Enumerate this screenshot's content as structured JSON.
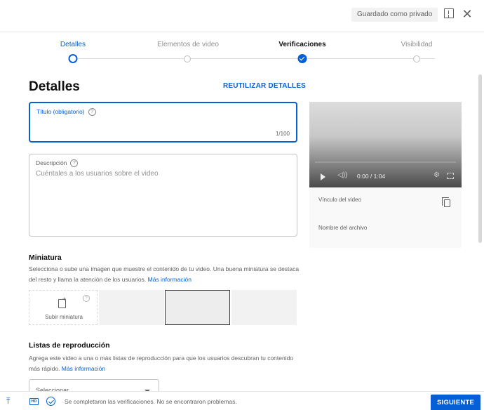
{
  "header": {
    "saved_status": "Guardado como privado",
    "feedback_icon": "feedback-icon",
    "close_icon": "close-icon"
  },
  "stepper": {
    "steps": [
      {
        "label": "Detalles",
        "state": "active"
      },
      {
        "label": "Elementos de video",
        "state": "future"
      },
      {
        "label": "Verificaciones",
        "state": "done"
      },
      {
        "label": "Visibilidad",
        "state": "future"
      }
    ]
  },
  "details": {
    "title": "Detalles",
    "reuse_label": "REUTILIZAR DETALLES",
    "title_field": {
      "label": "Título (obligatorio)",
      "help": "?",
      "value": "",
      "counter": "1/100"
    },
    "description_field": {
      "label": "Descripción",
      "help": "?",
      "placeholder": "Cuéntales a los usuarios sobre el video"
    }
  },
  "preview": {
    "time": "0:00 / 1:04",
    "link_label": "Vínculo del video",
    "filename_label": "Nombre del archivo"
  },
  "thumbnail": {
    "heading": "Miniatura",
    "text": "Selecciona o sube una imagen que muestre el contenido de tu video. Una buena miniatura se destaca del resto y llama la atención de los usuarios.",
    "link": "Más información",
    "upload_label": "Subir miniatura",
    "help": "?"
  },
  "playlists": {
    "heading": "Listas de reproducción",
    "text": "Agrega este video a una o más listas de reproducción para que los usuarios descubran tu contenido más rápido.",
    "link": "Más información",
    "select_value": "Seleccionar"
  },
  "footer": {
    "status": "Se completaron las verificaciones. No se encontraron problemas.",
    "next_label": "SIGUIENTE",
    "hd_label": "HD"
  },
  "colors": {
    "accent": "#065fd4",
    "text": "#0f0f0f",
    "secondary": "#606060"
  }
}
